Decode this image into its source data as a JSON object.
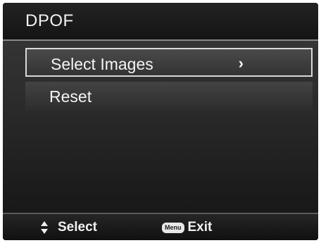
{
  "header": {
    "title": "DPOF"
  },
  "menu": {
    "items": [
      {
        "label": "Select Images",
        "arrow": "›"
      },
      {
        "label": "Reset"
      }
    ]
  },
  "footer": {
    "select_label": "Select",
    "menu_key_label": "Menu",
    "exit_label": "Exit"
  },
  "icons": {
    "navigate": "up-down-arrows-icon",
    "menu_key": "menu-button-icon"
  }
}
